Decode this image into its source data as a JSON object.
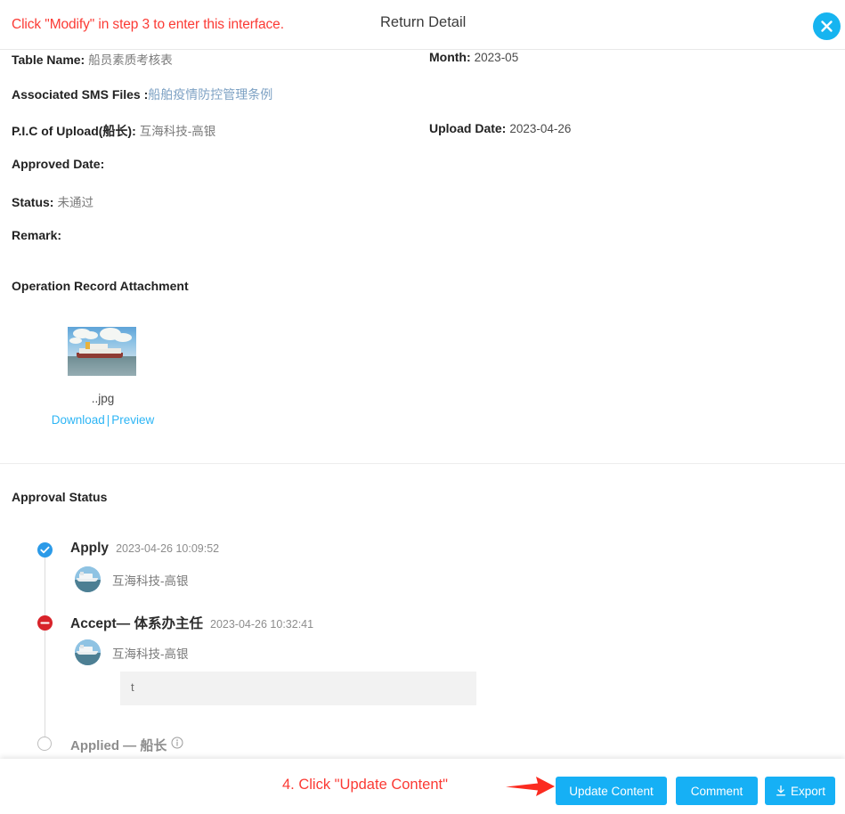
{
  "header": {
    "hint": "Click \"Modify\" in step 3 to enter this interface.",
    "title": "Return Detail",
    "close_icon": "close-circle-icon",
    "close_color": "#16b4f0"
  },
  "details": {
    "rows": [
      {
        "label": "Table Name:",
        "value": "船员素质考核表",
        "label2": "Month:",
        "value2": "2023-05"
      },
      {
        "label": "Associated SMS Files :",
        "link": "船舶疫情防控管理条例"
      },
      {
        "label": "P.I.C of Upload(船长):",
        "value": "互海科技-高银",
        "label2": "Upload Date:",
        "value2": "2023-04-26"
      },
      {
        "label": "Approved Date:",
        "value": ""
      },
      {
        "label": "Status:",
        "value": "未通过"
      },
      {
        "label": "Remark:",
        "value": ""
      }
    ]
  },
  "attachment": {
    "title": "Operation Record Attachment",
    "thumb_icon": "ship-photo-thumbnail",
    "file_name": "..jpg",
    "download_label": "Download",
    "separator": "|",
    "preview_label": "Preview",
    "link_color": "#2db5f5"
  },
  "approval": {
    "title": "Approval Status",
    "steps": [
      {
        "status_icon": "check-circle-icon",
        "status": "approved",
        "name": "Apply",
        "time": "2023-04-26 10:09:52",
        "user": "互海科技-高银",
        "comment": null
      },
      {
        "status_icon": "minus-circle-icon",
        "status": "rejected",
        "name": "Accept— 体系办主任",
        "time": "2023-04-26 10:32:41",
        "user": "互海科技-高银",
        "comment": "t"
      },
      {
        "status_icon": "empty-circle-icon",
        "status": "pending",
        "name": "Applied — 船长",
        "time": "",
        "user": null,
        "comment": null,
        "info_icon": "info-circle-icon"
      }
    ],
    "approved_color": "#2b9ae8",
    "rejected_color": "#d8232a"
  },
  "footer": {
    "hint": "4. Click \"Update Content\"",
    "arrow_icon": "red-arrow-right-icon",
    "update_label": "Update Content",
    "comment_label": "Comment",
    "export_label": "Export",
    "export_icon": "download-icon",
    "button_color": "#16b0f5",
    "hint_color": "#fb3a34"
  }
}
